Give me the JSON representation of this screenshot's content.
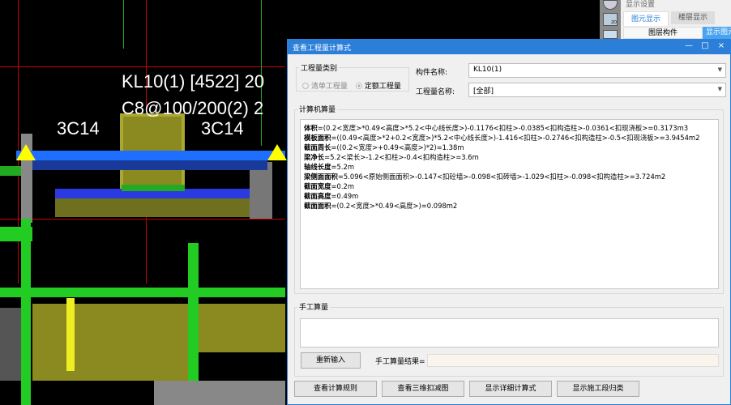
{
  "cad": {
    "beam_label": "KL10(1) [4522] 20",
    "stirrup_label": "C8@100/200(2) 2",
    "left_rebar": "3C14",
    "right_rebar": "3C14"
  },
  "side_panel": {
    "title": "显示设置",
    "tabs": [
      "图元显示",
      "楼层显示"
    ],
    "subtabs": [
      "图层构件",
      "显示图元"
    ],
    "icon_2d": "2D"
  },
  "dialog": {
    "title": "查看工程量计算式",
    "controls": {
      "minimize": "—",
      "maximize": "□",
      "close": "×"
    },
    "quantity_type": {
      "label": "工程量类别",
      "options": [
        "清单工程量",
        "定额工程量"
      ],
      "selected": "定额工程量"
    },
    "component_name": {
      "label": "构件名称:",
      "value": "KL10(1)"
    },
    "quantity_name": {
      "label": "工程量名称:",
      "value": "[全部]"
    },
    "computer_calc": {
      "label": "计算机算量",
      "lines": [
        {
          "name": "体积",
          "expr": "=(0.2<宽度>*0.49<高度>*5.2<中心线长度>)-0.1176<扣柱>-0.0385<扣构造柱>-0.0361<扣现浇板>=0.3173m3"
        },
        {
          "name": "模板面积",
          "expr": "=((0.49<高度>*2+0.2<宽度>)*5.2<中心线长度>)-1.416<扣柱>-0.2746<扣构造柱>-0.5<扣现浇板>=3.9454m2"
        },
        {
          "name": "截面周长",
          "expr": "=((0.2<宽度>+0.49<高度>)*2)=1.38m"
        },
        {
          "name": "梁净长",
          "expr": "=5.2<梁长>-1.2<扣柱>-0.4<扣构造柱>=3.6m"
        },
        {
          "name": "轴线长度",
          "expr": "=5.2m"
        },
        {
          "name": "梁侧面面积",
          "expr": "=5.096<原始侧面面积>-0.147<扣砼墙>-0.098<扣砖墙>-1.029<扣柱>-0.098<扣构造柱>=3.724m2"
        },
        {
          "name": "截面宽度",
          "expr": "=0.2m"
        },
        {
          "name": "截面高度",
          "expr": "=0.49m"
        },
        {
          "name": "截面面积",
          "expr": "=(0.2<宽度>*0.49<高度>)=0.098m2"
        }
      ]
    },
    "manual_calc": {
      "label": "手工算量",
      "reenter": "重新输入",
      "result_label": "手工算量结果=",
      "result_value": ""
    },
    "buttons": [
      "查看计算规则",
      "查看三维扣减图",
      "显示详细计算式",
      "显示施工段归类"
    ]
  }
}
